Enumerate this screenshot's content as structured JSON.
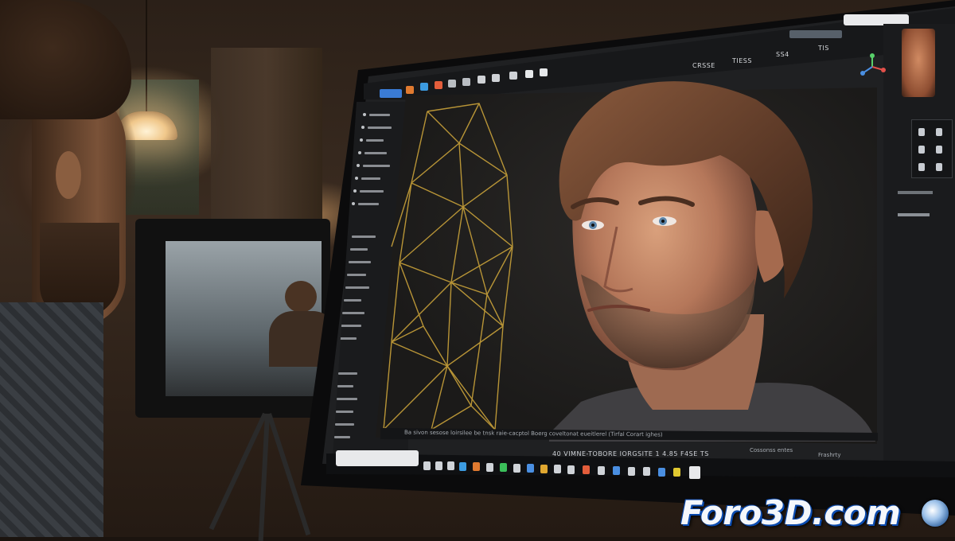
{
  "scene": {
    "description_tag": "photo of person viewing 3D character modeling software"
  },
  "app": {
    "tool_tabs": [
      "CRSSE",
      "TIESS",
      "SS4",
      "TIS"
    ],
    "status_text": "Ba sivon sesose loirsilee be tnsk raie-cacptol Boerg coveltonat eueitlerel (Tirfal Corart ighes)",
    "timeline_text": "40 VIMNE-TOBORE IORGSITE 1 4.85 F4SE TS",
    "status_right_1": "Cossonss entes",
    "status_right_2": "Frashrty"
  },
  "watermark": {
    "text": "Foro3D.com"
  },
  "colors": {
    "accent_blue": "#3a7bd5",
    "mesh_gold": "#c9a23a",
    "watermark_blue": "#0b4fb8"
  }
}
